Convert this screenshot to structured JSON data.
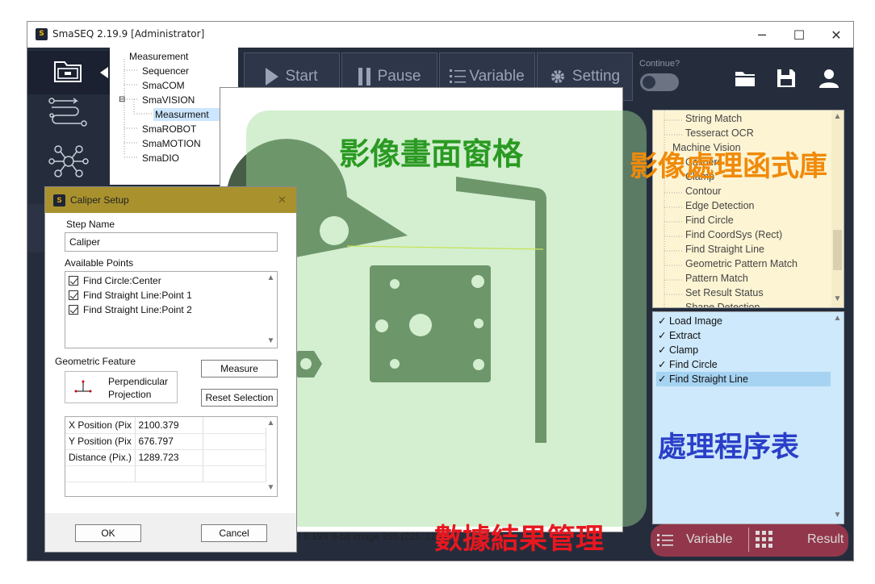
{
  "window": {
    "title": "SmaSEQ 2.19.9 [Administrator]",
    "minimize": "─",
    "maximize": "☐",
    "close": "✕"
  },
  "tree": {
    "items": [
      "Measurement",
      "Sequencer",
      "SmaCOM",
      "SmaVISION",
      "Measurment",
      "SmaROBOT",
      "SmaMOTION",
      "SmaDIO"
    ],
    "expander": "⊟"
  },
  "toolbar": {
    "start": "Start",
    "pause": "Pause",
    "variable": "Variable",
    "setting": "Setting",
    "continue_label": "Continue?"
  },
  "library": {
    "items": [
      "String Match",
      "Tesseract OCR",
      "Machine Vision",
      "Calipers",
      "Clamp",
      "Contour",
      "Edge Detection",
      "Find Circle",
      "Find CoordSys (Rect)",
      "Find Straight Line",
      "Geometric Pattern Match",
      "Pattern Match",
      "Set Result Status",
      "Shape Detection"
    ]
  },
  "process": {
    "items": [
      "Load Image",
      "Extract",
      "Clamp",
      "Find Circle",
      "Find Straight Line"
    ],
    "check": "✓",
    "selected_index": 4
  },
  "status": {
    "text": "2 0.19X 8-bit image 255    (225, 110)"
  },
  "bottom": {
    "variable": "Variable",
    "result": "Result"
  },
  "annotations": {
    "image_pane": "影像畫面窗格",
    "library": "影像處理函式庫",
    "process": "處理程序表",
    "results": "數據結果管理"
  },
  "dialog": {
    "title": "Caliper Setup",
    "close": "✕",
    "step_name_label": "Step Name",
    "step_name_value": "Caliper",
    "available_points_label": "Available Points",
    "points": [
      "Find Circle:Center",
      "Find Straight Line:Point 1",
      "Find Straight Line:Point 2"
    ],
    "geometric_feature_label": "Geometric Feature",
    "feature_name_line1": "Perpendicular",
    "feature_name_line2": "Projection",
    "measure": "Measure",
    "reset_selection": "Reset Selection",
    "results": [
      {
        "name": "X Position (Pix",
        "value": "2100.379"
      },
      {
        "name": "Y Position (Pix",
        "value": "676.797"
      },
      {
        "name": "Distance (Pix.)",
        "value": "1289.723"
      }
    ],
    "ok": "OK",
    "cancel": "Cancel"
  },
  "colors": {
    "annotation_green": "#2a9a22",
    "annotation_orange": "#f08a0a",
    "annotation_blue": "#2a3fc8",
    "annotation_red": "#e8171f",
    "part": "#485d48"
  }
}
